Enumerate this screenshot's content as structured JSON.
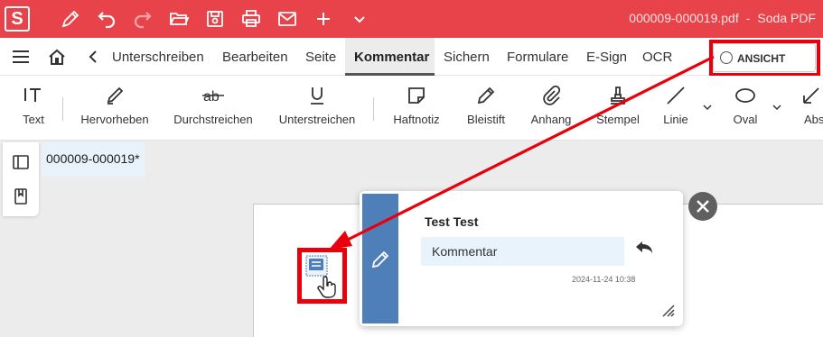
{
  "titlebar": {
    "logo": "S",
    "filename": "000009-000019.pdf",
    "separator": "-",
    "app_name": "Soda PDF",
    "icons": [
      "pen-icon",
      "undo-icon",
      "redo-icon",
      "open-folder-icon",
      "save-icon",
      "print-icon",
      "mail-icon",
      "new-plus-icon",
      "more-chevron-icon"
    ]
  },
  "menubar": {
    "items": [
      {
        "label": "Unterschreiben"
      },
      {
        "label": "Bearbeiten"
      },
      {
        "label": "Seite"
      },
      {
        "label": "Kommentar",
        "active": true
      },
      {
        "label": "Sichern"
      },
      {
        "label": "Formulare"
      },
      {
        "label": "E-Sign"
      },
      {
        "label": "OCR"
      }
    ],
    "view_toggle": "ANSICHT"
  },
  "toolbar": {
    "tools": [
      {
        "label": "Text",
        "icon": "text-cursor-icon"
      },
      {
        "label": "Hervorheben",
        "icon": "highlighter-icon"
      },
      {
        "label": "Durchstreichen",
        "icon": "strikethrough-icon"
      },
      {
        "label": "Unterstreichen",
        "icon": "underline-icon"
      },
      {
        "label": "Haftnotiz",
        "icon": "sticky-note-icon"
      },
      {
        "label": "Bleistift",
        "icon": "pencil-icon"
      },
      {
        "label": "Anhang",
        "icon": "paperclip-icon"
      },
      {
        "label": "Stempel",
        "icon": "stamp-icon"
      },
      {
        "label": "Linie",
        "icon": "line-icon"
      },
      {
        "label": "Oval",
        "icon": "oval-icon"
      },
      {
        "label": "Abs",
        "icon": "arrow-shape-icon"
      }
    ]
  },
  "document": {
    "tab_name": "000009-000019*"
  },
  "comment": {
    "author": "Test Test",
    "text": "Kommentar",
    "timestamp": "2024-11-24 10:38"
  },
  "colors": {
    "brand": "#e8434a",
    "annotation_highlight": "#e8000b",
    "comment_strip": "#4f7fb8",
    "comment_bubble": "#e8f3fb"
  }
}
